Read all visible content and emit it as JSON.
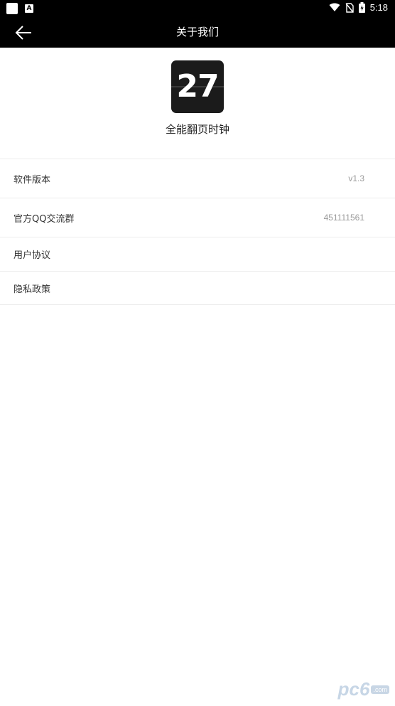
{
  "status_bar": {
    "time": "5:18",
    "left_icons": [
      "notification-square-icon",
      "a-letter-icon"
    ],
    "right_icons": [
      "wifi-icon",
      "no-sim-icon",
      "battery-charging-icon"
    ]
  },
  "toolbar": {
    "title": "关于我们",
    "back_icon": "arrow-left-icon",
    "background": "#000000"
  },
  "app": {
    "icon_text": "27",
    "name": "全能翻页时钟"
  },
  "rows": [
    {
      "label": "软件版本",
      "value": "v1.3"
    },
    {
      "label": "官方QQ交流群",
      "value": "451111561"
    },
    {
      "label": "用户协议",
      "value": ""
    },
    {
      "label": "隐私政策",
      "value": ""
    }
  ],
  "watermark": {
    "text": "pc6",
    "tag": ".com"
  }
}
